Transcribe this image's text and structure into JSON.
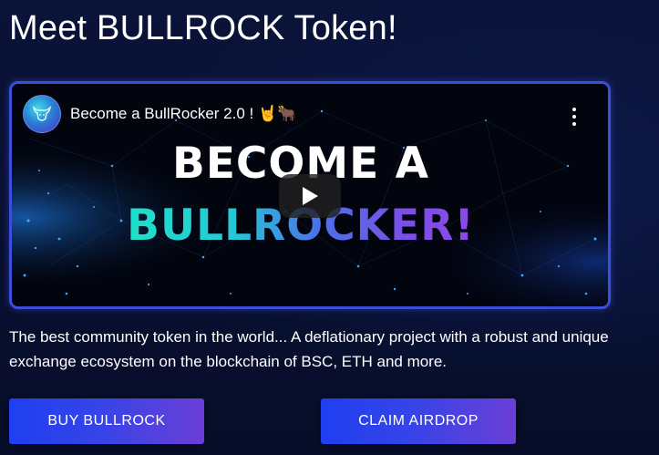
{
  "heading": "Meet BULLROCK Token!",
  "video": {
    "title": "Become a BullRocker 2.0 ! 🤘🐂",
    "headline_line1": "BECOME A",
    "headline_line2": "BULLROCKER!",
    "channel_avatar_icon": "bull-logo-icon",
    "menu_icon": "more-vertical-icon",
    "play_icon": "play-icon"
  },
  "description": "The best community token in the world... A deflationary project with a robust and unique exchange ecosystem on the blockchain of BSC, ETH and more.",
  "buttons": {
    "buy_label": "BUY BULLROCK",
    "claim_label": "CLAIM AIRDROP"
  },
  "colors": {
    "background": "#08102e",
    "frame_border": "#3b4fd8",
    "button_gradient_start": "#1f3ff0",
    "button_gradient_end": "#6a3fd6",
    "headline_gradient_start": "#1ee0c8",
    "headline_gradient_end": "#8d49e8"
  }
}
